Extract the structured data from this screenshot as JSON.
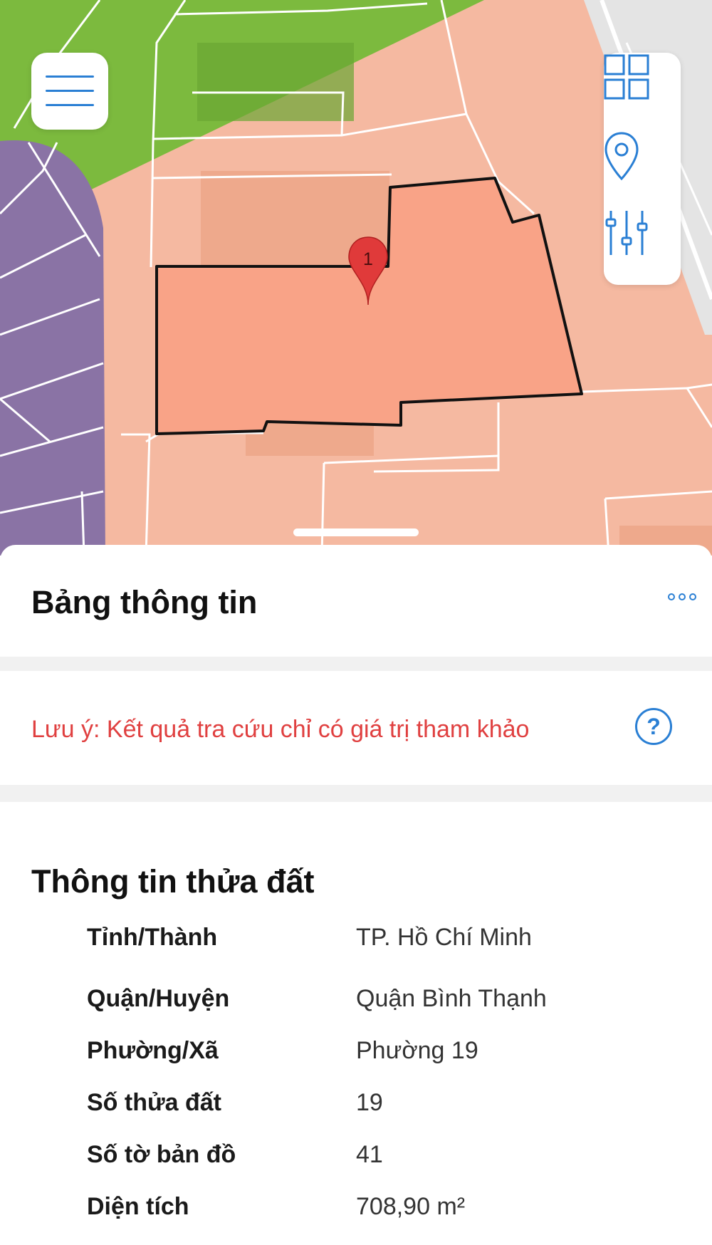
{
  "map": {
    "marker_label": "1",
    "colors": {
      "residential": "#f5b9a1",
      "parcel_fill": "#f9a387",
      "green_zone": "#7cba3e",
      "purple_zone": "#8a73a5",
      "road": "#e4e4e4",
      "accent": "#2a7fd4",
      "marker": "#e03a3a"
    }
  },
  "toolbar": {
    "menu_icon": "hamburger-menu-icon",
    "layers_icon": "grid-layers-icon",
    "location_icon": "location-pin-icon",
    "filter_icon": "sliders-icon"
  },
  "sheet": {
    "title": "Bảng thông tin",
    "more_icon": "more-dots-icon",
    "notice": "Lưu ý: Kết quả tra cứu chỉ có giá trị tham khảo",
    "help_label": "?"
  },
  "parcel": {
    "title": "Thông tin thửa đất",
    "rows": [
      {
        "label": "Tỉnh/Thành",
        "value": "TP. Hồ Chí Minh"
      },
      {
        "label": "Quận/Huyện",
        "value": "Quận Bình Thạnh"
      },
      {
        "label": "Phường/Xã",
        "value": "Phường 19"
      },
      {
        "label": "Số thửa đất",
        "value": "19"
      },
      {
        "label": "Số tờ bản đồ",
        "value": "41"
      },
      {
        "label": "Diện tích",
        "value": "708,90 m²"
      }
    ]
  }
}
